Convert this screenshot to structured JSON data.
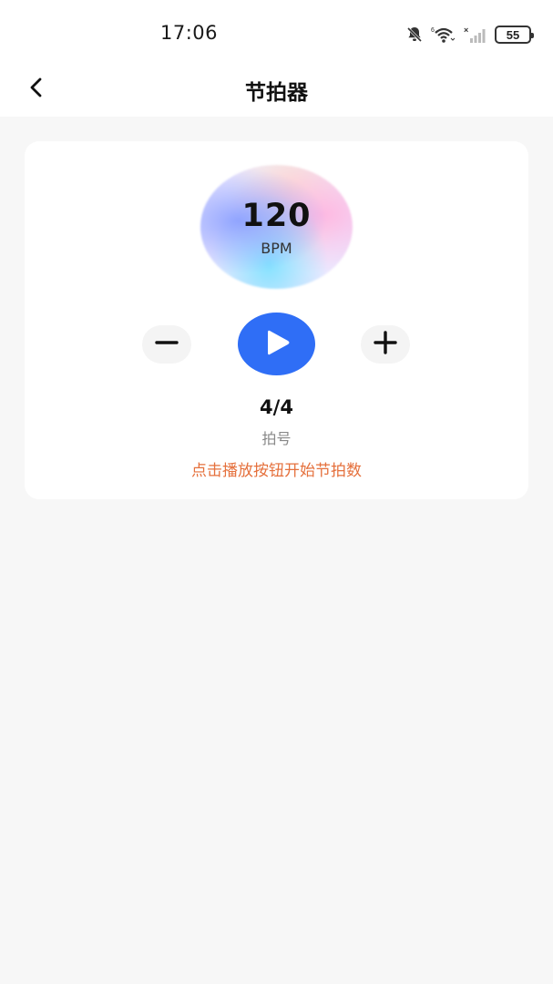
{
  "status_bar": {
    "time": "17:06",
    "icons": [
      "bell-muted-icon",
      "wifi-icon",
      "signal-icon"
    ],
    "battery": "55"
  },
  "nav": {
    "back_icon": "chevron-left-icon",
    "title": "节拍器"
  },
  "metronome": {
    "bpm": "120",
    "bpm_unit": "BPM",
    "time_signature": "4/4",
    "time_signature_label": "拍号",
    "hint": "点击播放按钮开始节拍数",
    "decrease_icon": "minus-icon",
    "play_icon": "play-icon",
    "increase_icon": "plus-icon"
  },
  "colors": {
    "accent": "#2f6ef6",
    "hint": "#e5703c",
    "background": "#f7f7f7",
    "card": "#ffffff"
  }
}
